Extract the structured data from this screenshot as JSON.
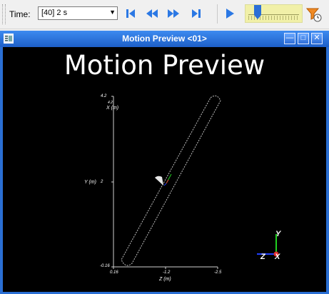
{
  "toolbar": {
    "time_label": "Time:",
    "time_value": "[40] 2 s",
    "buttons": [
      "go-to-start",
      "step-back",
      "step-forward",
      "go-to-end",
      "play"
    ],
    "time_slider_position": 0.13
  },
  "window": {
    "title": "Motion Preview <01>",
    "controls": [
      "minimize",
      "maximize",
      "close"
    ]
  },
  "viewport": {
    "heading": "Motion Preview",
    "y_axis_label": "Y (m)",
    "y_axis_tick": "2",
    "x_axis_label": "X (m)",
    "x_axis_tick_top": "4.2",
    "x_axis_tick_top_stack": "4.2",
    "x_axis_tick_bottom": "-0.16",
    "z_axis_label": "Z (m)",
    "z_ticks": [
      "0.16",
      "-1.2",
      "-2.5"
    ],
    "triad": {
      "y": "Y",
      "z": "Z",
      "x": "X"
    },
    "colors": {
      "x_axis": "#e03030",
      "y_axis": "#20d020",
      "z_axis": "#2040ff",
      "background": "#000000"
    }
  }
}
